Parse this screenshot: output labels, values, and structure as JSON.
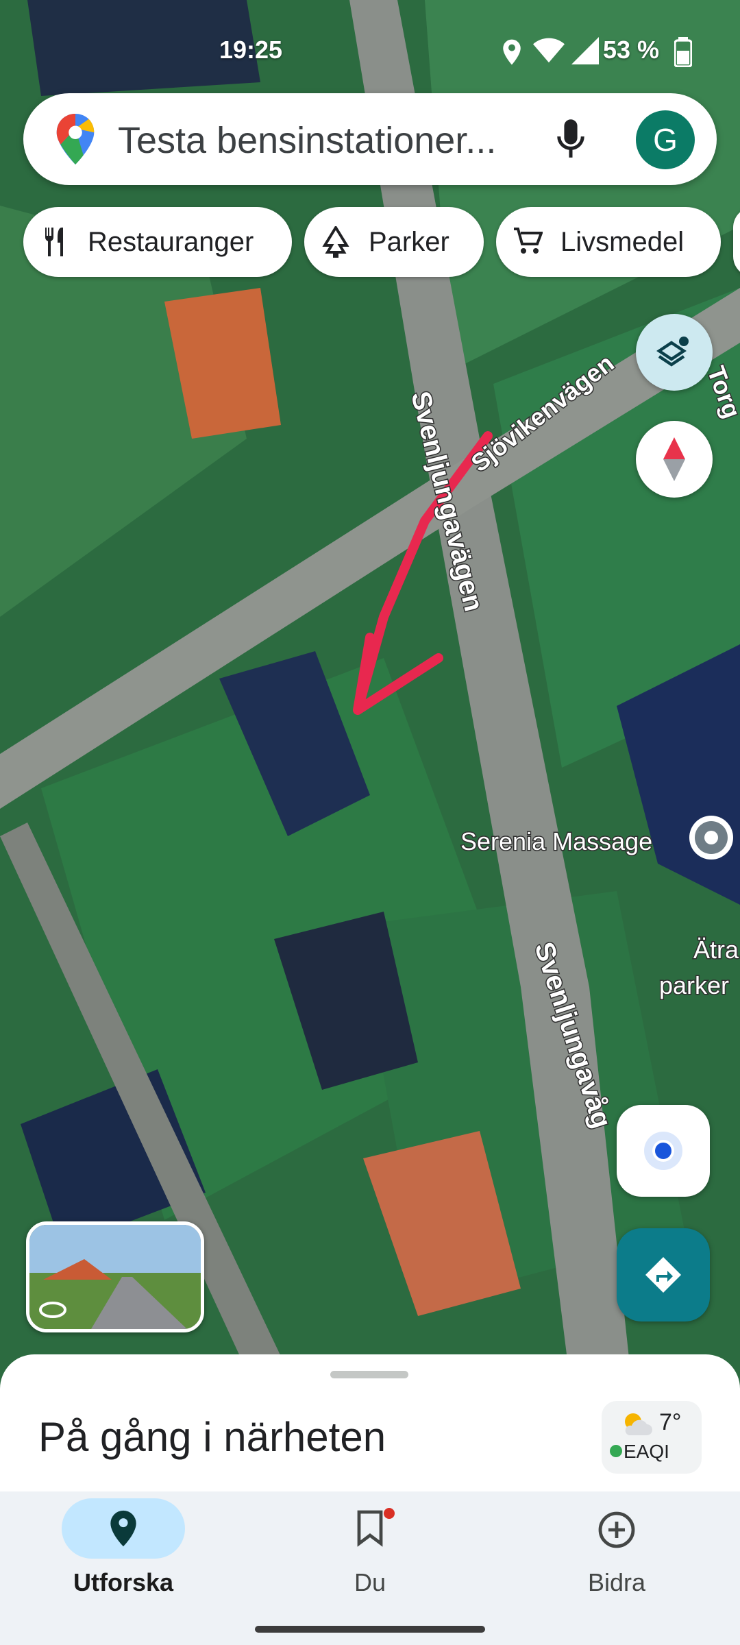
{
  "status_bar": {
    "time": "19:25",
    "battery": "53 %"
  },
  "search": {
    "placeholder": "Testa bensinstationer...",
    "avatar_letter": "G"
  },
  "chips": [
    {
      "label": "Restauranger",
      "icon": "restaurant-icon"
    },
    {
      "label": "Parker",
      "icon": "park-icon"
    },
    {
      "label": "Livsmedel",
      "icon": "cart-icon"
    }
  ],
  "map": {
    "labels": {
      "road_1": "Sjövikenvägen",
      "road_2": "Svenljungavägen",
      "road_3": "Svenljungavåg",
      "road_4": "Torg",
      "place_1": "Serenia Massage",
      "place_2_line1": "Ätra",
      "place_2_line2": "parker"
    },
    "icons": [
      "layers-icon",
      "compass-icon",
      "my-location-icon",
      "directions-icon",
      "street-view-icon",
      "place-pin-icon"
    ],
    "annotation_color": "#e8284f"
  },
  "sheet": {
    "title": "På gång i närheten",
    "temperature": "7°",
    "air_quality": "EAQI"
  },
  "nav": {
    "items": [
      {
        "label": "Utforska"
      },
      {
        "label": "Du"
      },
      {
        "label": "Bidra"
      }
    ]
  },
  "colors": {
    "accent": "#0b7b66",
    "nav_active": "#c2e7ff",
    "directions": "#0c7c8a"
  }
}
